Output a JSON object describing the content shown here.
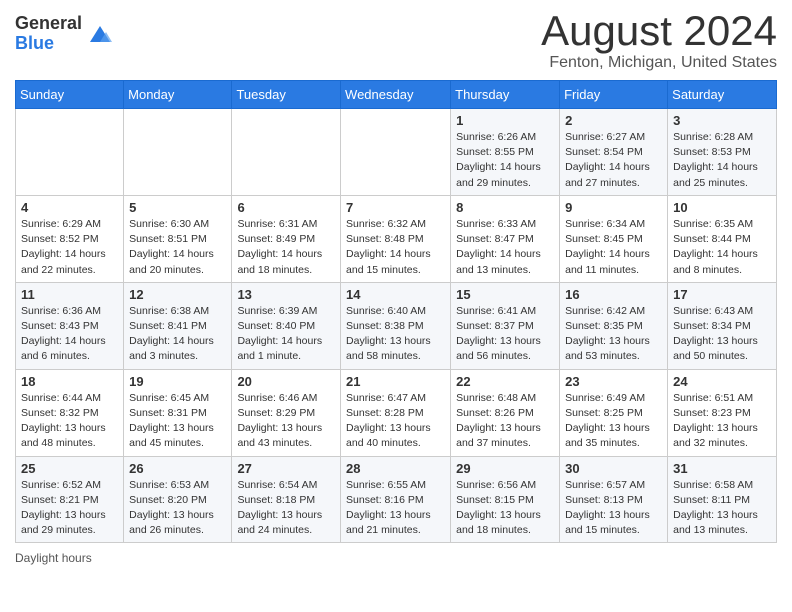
{
  "header": {
    "logo_line1": "General",
    "logo_line2": "Blue",
    "month_title": "August 2024",
    "location": "Fenton, Michigan, United States"
  },
  "days_of_week": [
    "Sunday",
    "Monday",
    "Tuesday",
    "Wednesday",
    "Thursday",
    "Friday",
    "Saturday"
  ],
  "weeks": [
    [
      {
        "day": "",
        "info": ""
      },
      {
        "day": "",
        "info": ""
      },
      {
        "day": "",
        "info": ""
      },
      {
        "day": "",
        "info": ""
      },
      {
        "day": "1",
        "info": "Sunrise: 6:26 AM\nSunset: 8:55 PM\nDaylight: 14 hours and 29 minutes."
      },
      {
        "day": "2",
        "info": "Sunrise: 6:27 AM\nSunset: 8:54 PM\nDaylight: 14 hours and 27 minutes."
      },
      {
        "day": "3",
        "info": "Sunrise: 6:28 AM\nSunset: 8:53 PM\nDaylight: 14 hours and 25 minutes."
      }
    ],
    [
      {
        "day": "4",
        "info": "Sunrise: 6:29 AM\nSunset: 8:52 PM\nDaylight: 14 hours and 22 minutes."
      },
      {
        "day": "5",
        "info": "Sunrise: 6:30 AM\nSunset: 8:51 PM\nDaylight: 14 hours and 20 minutes."
      },
      {
        "day": "6",
        "info": "Sunrise: 6:31 AM\nSunset: 8:49 PM\nDaylight: 14 hours and 18 minutes."
      },
      {
        "day": "7",
        "info": "Sunrise: 6:32 AM\nSunset: 8:48 PM\nDaylight: 14 hours and 15 minutes."
      },
      {
        "day": "8",
        "info": "Sunrise: 6:33 AM\nSunset: 8:47 PM\nDaylight: 14 hours and 13 minutes."
      },
      {
        "day": "9",
        "info": "Sunrise: 6:34 AM\nSunset: 8:45 PM\nDaylight: 14 hours and 11 minutes."
      },
      {
        "day": "10",
        "info": "Sunrise: 6:35 AM\nSunset: 8:44 PM\nDaylight: 14 hours and 8 minutes."
      }
    ],
    [
      {
        "day": "11",
        "info": "Sunrise: 6:36 AM\nSunset: 8:43 PM\nDaylight: 14 hours and 6 minutes."
      },
      {
        "day": "12",
        "info": "Sunrise: 6:38 AM\nSunset: 8:41 PM\nDaylight: 14 hours and 3 minutes."
      },
      {
        "day": "13",
        "info": "Sunrise: 6:39 AM\nSunset: 8:40 PM\nDaylight: 14 hours and 1 minute."
      },
      {
        "day": "14",
        "info": "Sunrise: 6:40 AM\nSunset: 8:38 PM\nDaylight: 13 hours and 58 minutes."
      },
      {
        "day": "15",
        "info": "Sunrise: 6:41 AM\nSunset: 8:37 PM\nDaylight: 13 hours and 56 minutes."
      },
      {
        "day": "16",
        "info": "Sunrise: 6:42 AM\nSunset: 8:35 PM\nDaylight: 13 hours and 53 minutes."
      },
      {
        "day": "17",
        "info": "Sunrise: 6:43 AM\nSunset: 8:34 PM\nDaylight: 13 hours and 50 minutes."
      }
    ],
    [
      {
        "day": "18",
        "info": "Sunrise: 6:44 AM\nSunset: 8:32 PM\nDaylight: 13 hours and 48 minutes."
      },
      {
        "day": "19",
        "info": "Sunrise: 6:45 AM\nSunset: 8:31 PM\nDaylight: 13 hours and 45 minutes."
      },
      {
        "day": "20",
        "info": "Sunrise: 6:46 AM\nSunset: 8:29 PM\nDaylight: 13 hours and 43 minutes."
      },
      {
        "day": "21",
        "info": "Sunrise: 6:47 AM\nSunset: 8:28 PM\nDaylight: 13 hours and 40 minutes."
      },
      {
        "day": "22",
        "info": "Sunrise: 6:48 AM\nSunset: 8:26 PM\nDaylight: 13 hours and 37 minutes."
      },
      {
        "day": "23",
        "info": "Sunrise: 6:49 AM\nSunset: 8:25 PM\nDaylight: 13 hours and 35 minutes."
      },
      {
        "day": "24",
        "info": "Sunrise: 6:51 AM\nSunset: 8:23 PM\nDaylight: 13 hours and 32 minutes."
      }
    ],
    [
      {
        "day": "25",
        "info": "Sunrise: 6:52 AM\nSunset: 8:21 PM\nDaylight: 13 hours and 29 minutes."
      },
      {
        "day": "26",
        "info": "Sunrise: 6:53 AM\nSunset: 8:20 PM\nDaylight: 13 hours and 26 minutes."
      },
      {
        "day": "27",
        "info": "Sunrise: 6:54 AM\nSunset: 8:18 PM\nDaylight: 13 hours and 24 minutes."
      },
      {
        "day": "28",
        "info": "Sunrise: 6:55 AM\nSunset: 8:16 PM\nDaylight: 13 hours and 21 minutes."
      },
      {
        "day": "29",
        "info": "Sunrise: 6:56 AM\nSunset: 8:15 PM\nDaylight: 13 hours and 18 minutes."
      },
      {
        "day": "30",
        "info": "Sunrise: 6:57 AM\nSunset: 8:13 PM\nDaylight: 13 hours and 15 minutes."
      },
      {
        "day": "31",
        "info": "Sunrise: 6:58 AM\nSunset: 8:11 PM\nDaylight: 13 hours and 13 minutes."
      }
    ]
  ],
  "footer": {
    "note": "Daylight hours"
  }
}
